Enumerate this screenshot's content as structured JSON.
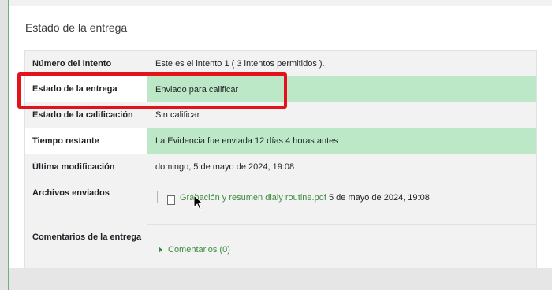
{
  "section_title": "Estado de la entrega",
  "rows": [
    {
      "label": "Número del intento",
      "value": "Este es el intento 1 ( 3 intentos permitidos )."
    },
    {
      "label": "Estado de la entrega",
      "value": "Enviado para calificar"
    },
    {
      "label": "Estado de la calificación",
      "value": "Sin calificar"
    },
    {
      "label": "Tiempo restante",
      "value": "La Evidencia fue enviada 12 días 4 horas antes"
    },
    {
      "label": "Última modificación",
      "value": "domingo, 5 de mayo de 2024, 19:08"
    },
    {
      "label": "Archivos enviados"
    },
    {
      "label": "Comentarios de la entrega"
    }
  ],
  "file": {
    "name": "Grabación y resumen dialy routine.pdf",
    "date": "5 de mayo de 2024, 19:08"
  },
  "comments": {
    "label": "Comentarios (0)"
  },
  "colors": {
    "success_bg": "#bde8c8",
    "link": "#3c8c3c",
    "highlight": "#e3131c"
  }
}
